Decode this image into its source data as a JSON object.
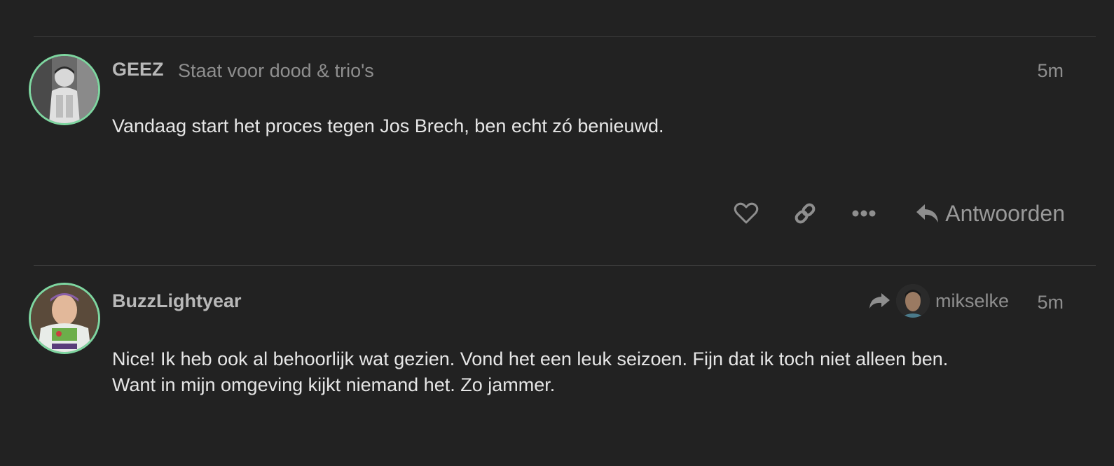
{
  "posts": [
    {
      "username": "GEEZ",
      "user_title": "Staat voor dood & trio's",
      "time": "5m",
      "body": [
        "Vandaag start het proces tegen Jos Brech, ben echt zó benieuwd."
      ],
      "actions": {
        "like_icon": "heart-icon",
        "link_icon": "link-icon",
        "more_icon": "ellipsis-icon",
        "reply_icon": "reply-icon",
        "reply_label": "Antwoorden"
      }
    },
    {
      "username": "BuzzLightyear",
      "time": "5m",
      "reply_to": {
        "icon": "share-arrow-icon",
        "username": "mikselke"
      },
      "body": [
        "Nice! Ik heb ook al behoorlijk wat gezien. Vond het een leuk seizoen. Fijn dat ik toch niet alleen ben.",
        "Want in mijn omgeving kijkt niemand het. Zo jammer."
      ]
    }
  ],
  "colors": {
    "background": "#222222",
    "avatar_ring": "#7ed6a0",
    "username": "#b9b9b9",
    "secondary_text": "#8e8e8e",
    "body_text": "#e6e6e6",
    "divider": "#3a3a3a"
  }
}
